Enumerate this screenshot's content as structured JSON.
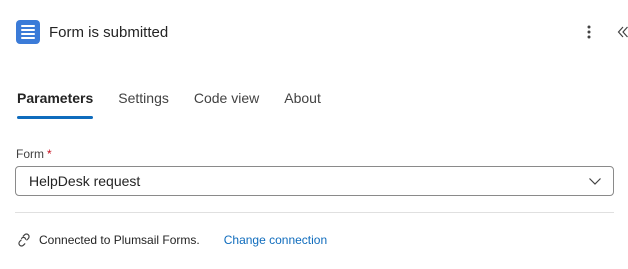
{
  "header": {
    "title": "Form is submitted",
    "app_icon": "forms-list-icon",
    "more_icon": "more-vertical-icon",
    "collapse_icon": "double-chevron-left-icon"
  },
  "tabs": [
    {
      "label": "Parameters",
      "active": true
    },
    {
      "label": "Settings",
      "active": false
    },
    {
      "label": "Code view",
      "active": false
    },
    {
      "label": "About",
      "active": false
    }
  ],
  "form_field": {
    "label": "Form",
    "required_marker": "*",
    "selected_value": "HelpDesk request"
  },
  "footer": {
    "connection_text": "Connected to Plumsail Forms.",
    "change_link": "Change connection"
  },
  "colors": {
    "accent": "#0f6cbd",
    "app_icon_bg": "#3b7bd8",
    "required": "#c50f1f"
  }
}
